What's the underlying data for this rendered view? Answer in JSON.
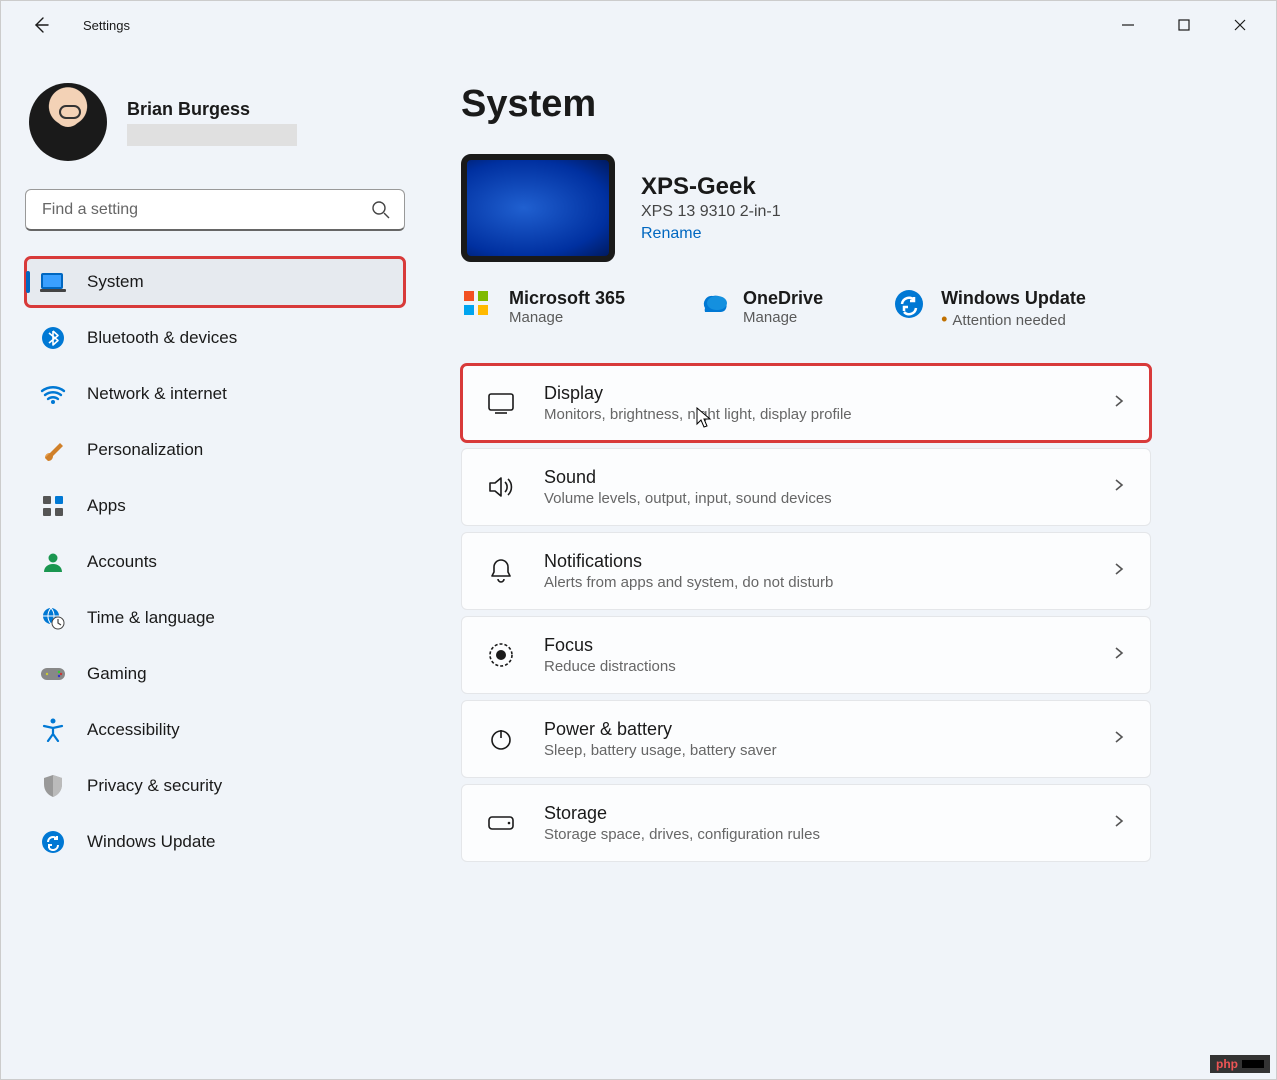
{
  "window": {
    "title": "Settings"
  },
  "profile": {
    "name": "Brian Burgess"
  },
  "search": {
    "placeholder": "Find a setting"
  },
  "nav": [
    {
      "label": "System",
      "icon": "system"
    },
    {
      "label": "Bluetooth & devices",
      "icon": "bluetooth"
    },
    {
      "label": "Network & internet",
      "icon": "wifi"
    },
    {
      "label": "Personalization",
      "icon": "brush"
    },
    {
      "label": "Apps",
      "icon": "apps"
    },
    {
      "label": "Accounts",
      "icon": "person"
    },
    {
      "label": "Time & language",
      "icon": "globe-clock"
    },
    {
      "label": "Gaming",
      "icon": "gamepad"
    },
    {
      "label": "Accessibility",
      "icon": "accessibility"
    },
    {
      "label": "Privacy & security",
      "icon": "shield"
    },
    {
      "label": "Windows Update",
      "icon": "update"
    }
  ],
  "page": {
    "title": "System",
    "device": {
      "name": "XPS-Geek",
      "model": "XPS 13 9310 2-in-1",
      "rename": "Rename"
    },
    "subs": [
      {
        "title": "Microsoft 365",
        "desc": "Manage",
        "icon": "ms365"
      },
      {
        "title": "OneDrive",
        "desc": "Manage",
        "icon": "onedrive"
      },
      {
        "title": "Windows Update",
        "desc": "Attention needed",
        "icon": "update",
        "attn": true
      }
    ],
    "cards": [
      {
        "title": "Display",
        "desc": "Monitors, brightness, night light, display profile",
        "icon": "display"
      },
      {
        "title": "Sound",
        "desc": "Volume levels, output, input, sound devices",
        "icon": "sound"
      },
      {
        "title": "Notifications",
        "desc": "Alerts from apps and system, do not disturb",
        "icon": "bell"
      },
      {
        "title": "Focus",
        "desc": "Reduce distractions",
        "icon": "focus"
      },
      {
        "title": "Power & battery",
        "desc": "Sleep, battery usage, battery saver",
        "icon": "power"
      },
      {
        "title": "Storage",
        "desc": "Storage space, drives, configuration rules",
        "icon": "storage"
      }
    ]
  }
}
